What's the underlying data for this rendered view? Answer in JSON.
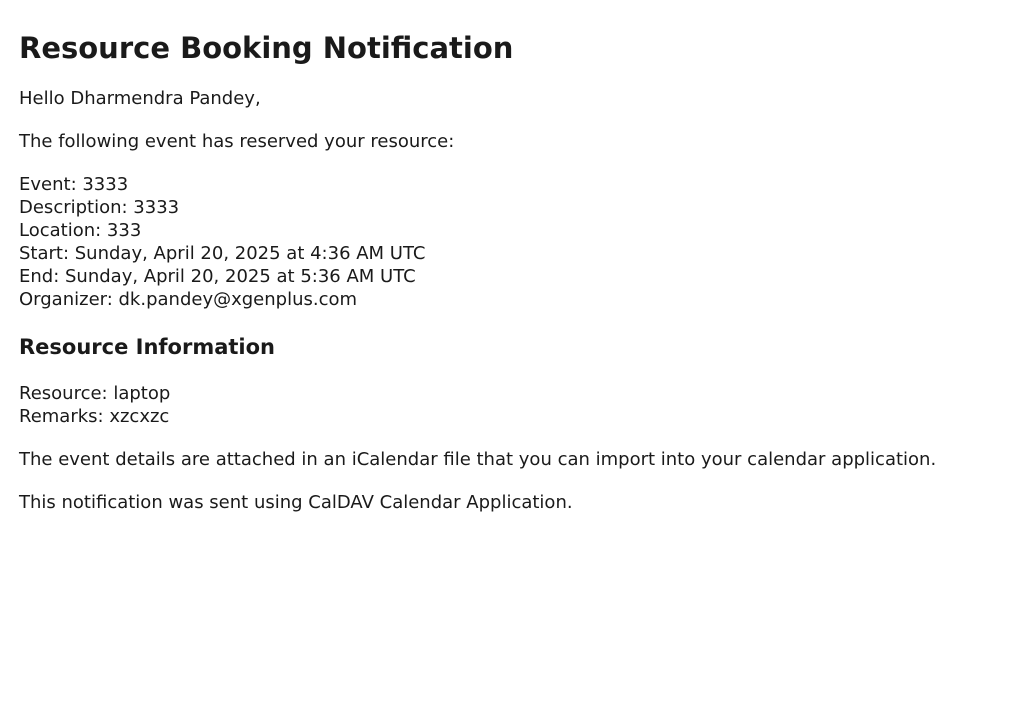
{
  "title": "Resource Booking Notification",
  "greeting": "Hello Dharmendra Pandey,",
  "intro": "The following event has reserved your resource:",
  "event": {
    "event": "Event: 3333",
    "description": "Description: 3333",
    "location": "Location: 333",
    "start": "Start: Sunday, April 20, 2025 at 4:36 AM UTC",
    "end": "End: Sunday, April 20, 2025 at 5:36 AM UTC",
    "organizer": "Organizer: dk.pandey@xgenplus.com"
  },
  "resource_section": {
    "heading": "Resource Information",
    "resource": "Resource: laptop",
    "remarks": "Remarks: xzcxzc"
  },
  "attachment_note": "The event details are attached in an iCalendar file that you can import into your calendar application.",
  "footer_note": "This notification was sent using CalDAV Calendar Application."
}
